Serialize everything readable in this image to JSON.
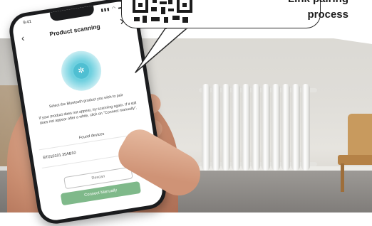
{
  "callout": {
    "line1": "Link pairing",
    "line2": "process"
  },
  "phone": {
    "status_time": "9:41",
    "status_icons": "▮▮▮ ◠ ▬",
    "title": "Product scanning",
    "back_icon": "chevron-left-icon",
    "close_icon": "close-icon",
    "bluetooth_icon": "bluetooth-icon",
    "instruction_main": "Select the Bluetooth product you wish to pair",
    "instruction_help": "If your product does not appear, try scanning again. If it still does not appear after a while, click on \"Connect manually\".",
    "found_devices_label": "Found devices",
    "device_name": "BT010101 35AB10",
    "rescan_label": "Rescan",
    "connect_manually_label": "Connect Manually",
    "accent_color": "#7fb98a",
    "scan_color": "#6fd0df"
  }
}
